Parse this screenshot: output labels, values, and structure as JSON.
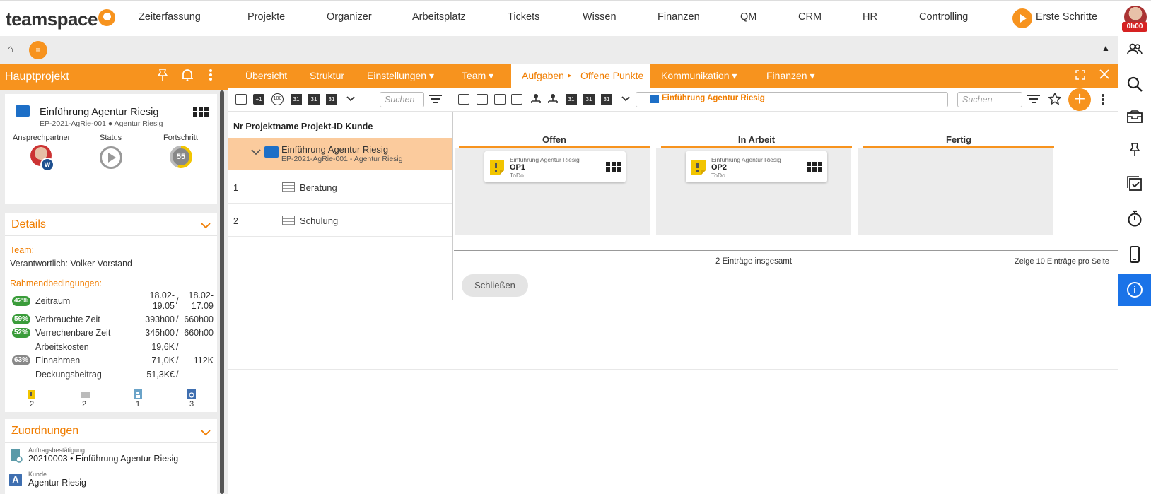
{
  "topnav": {
    "logo": "teamspace",
    "items": [
      "Zeiterfassung",
      "Projekte",
      "Organizer",
      "Arbeitsplatz",
      "Tickets",
      "Wissen",
      "Finanzen",
      "QM",
      "CRM",
      "HR",
      "Controlling"
    ],
    "erste_schritte": "Erste Schritte",
    "user_time": "0h00"
  },
  "secondbar": {
    "menu_symbol": "≡"
  },
  "left": {
    "title": "Hauptprojekt",
    "project": {
      "name": "Einführung Agentur Riesig",
      "sub": "EP-2021-AgRie-001 ● Agentur Riesig",
      "col_contact": "Ansprechpartner",
      "col_status": "Status",
      "col_progress": "Fortschritt",
      "contact_badge": "W",
      "progress": "55"
    },
    "details": {
      "title": "Details",
      "team_label": "Team:",
      "responsible": "Verantwortlich: Volker Vorstand",
      "conditions_label": "Rahmendbedingungen:",
      "rows": [
        {
          "badge": "42%",
          "label": "Zeitraum",
          "v1": "18.02-19.05",
          "sep": "/",
          "v2": "18.02-17.09"
        },
        {
          "badge": "59%",
          "label": "Verbrauchte Zeit",
          "v1": "393h00",
          "sep": "/",
          "v2": "660h00"
        },
        {
          "badge": "52%",
          "label": "Verrechenbare Zeit",
          "v1": "345h00",
          "sep": "/",
          "v2": "660h00"
        },
        {
          "badge": "",
          "label": "Arbeitskosten",
          "v1": "19,6K",
          "sep": "/",
          "v2": ""
        },
        {
          "badge": "63%",
          "label": "Einnahmen",
          "v1": "71,0K",
          "sep": "/",
          "v2": "112K"
        },
        {
          "badge": "",
          "label": "Deckungsbeitrag",
          "v1": "51,3K€",
          "sep": "/",
          "v2": ""
        }
      ],
      "counts": [
        "2",
        "2",
        "1",
        "3"
      ]
    },
    "assignments": {
      "title": "Zuordnungen",
      "items": [
        {
          "small": "Auftragsbestätigung",
          "text": "20210003 • Einführung Agentur Riesig"
        },
        {
          "small": "Kunde",
          "text": "Agentur Riesig",
          "icon_letter": "A"
        }
      ]
    }
  },
  "tabs": {
    "items": [
      "Übersicht",
      "Struktur",
      "Einstellungen ▾",
      "Team ▾",
      "Kommunikation ▾",
      "Finanzen ▾"
    ],
    "active": "Aufgaben",
    "active_sub": "Offene Punkte",
    "active_arrow": "▸"
  },
  "toolbar": {
    "search_placeholder": "Suchen",
    "search2_placeholder": "Suchen",
    "breadcrumb": "Einführung Agentur Riesig",
    "cal_label": "31",
    "plus1": "+1",
    "percent": "100"
  },
  "tree": {
    "header": "Nr Projektname Projekt-ID Kunde",
    "selected": {
      "name": "Einführung Agentur Riesig",
      "sub": "EP-2021-AgRie-001 - Agentur Riesig"
    },
    "rows": [
      {
        "nr": "1",
        "label": "Beratung"
      },
      {
        "nr": "2",
        "label": "Schulung"
      }
    ]
  },
  "kanban": {
    "columns": [
      {
        "title": "Offen",
        "cards": [
          {
            "project": "Einführung Agentur Riesig",
            "name": "OP1",
            "state": "ToDo"
          }
        ]
      },
      {
        "title": "In Arbeit",
        "cards": [
          {
            "project": "Einführung Agentur Riesig",
            "name": "OP2",
            "state": "ToDo"
          }
        ]
      },
      {
        "title": "Fertig",
        "cards": []
      }
    ],
    "total": "2 Einträge insgesamt",
    "per_page_prefix": "Zeige",
    "per_page_value": "10",
    "per_page_suffix": "Einträge pro Seite",
    "close_label": "Schließen"
  },
  "colors": {
    "accent": "#f7931e",
    "accent_text": "#f07d00",
    "selected_row": "#fbcb9d",
    "info_blue": "#1a73e8",
    "badge_green": "#3a9c3a",
    "badge_gray": "#888888"
  }
}
